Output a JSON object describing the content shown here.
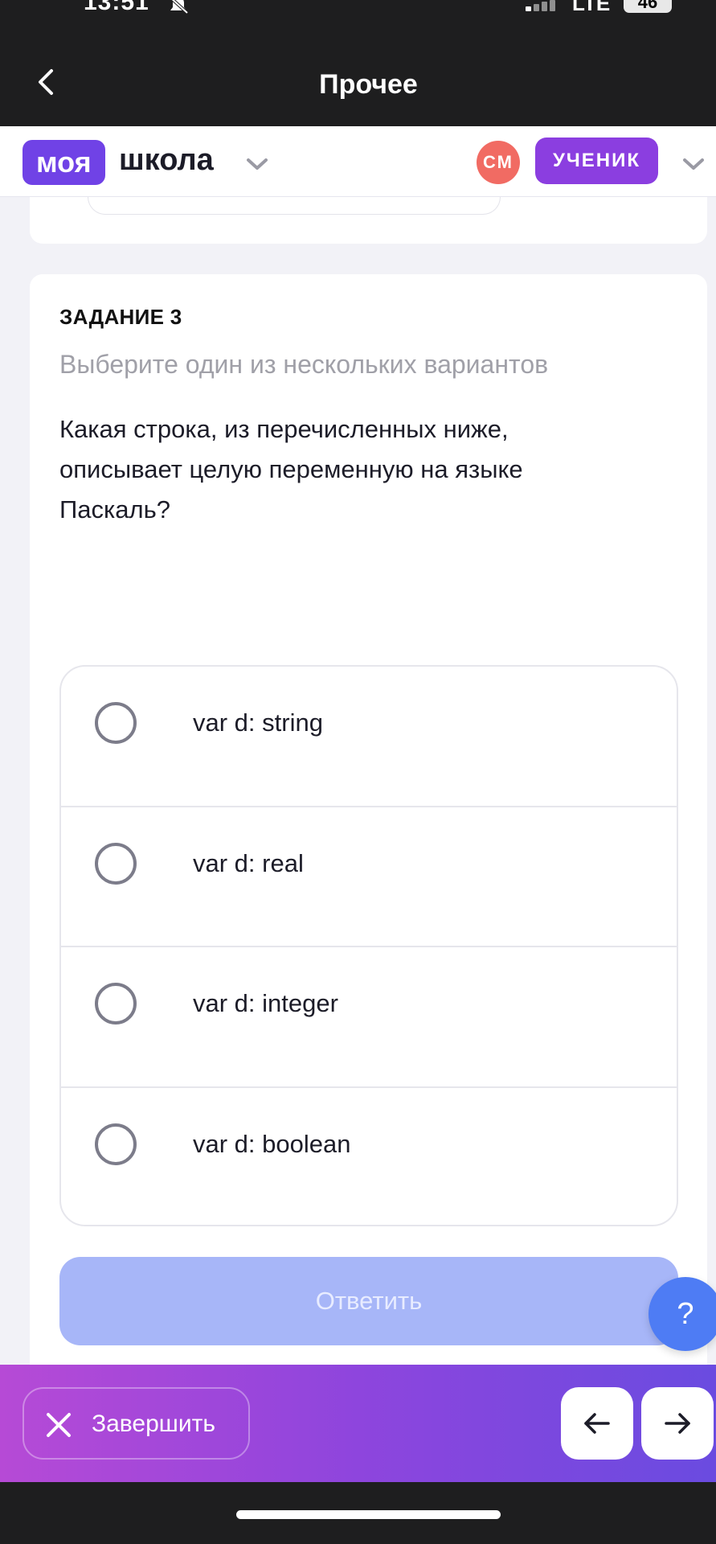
{
  "status_bar": {
    "time": "13:51",
    "network": "LTE",
    "battery": "46"
  },
  "title_bar": {
    "title": "Прочее"
  },
  "header": {
    "logo_part1": "моя",
    "logo_part2": "школа",
    "avatar_initials": "СМ",
    "role": "УЧЕНИК"
  },
  "task": {
    "title": "ЗАДАНИЕ 3",
    "subtitle": "Выберите один из нескольких вариантов",
    "question": "Какая строка, из перечисленных ниже, описывает целую переменную на языке Паскаль?",
    "options": [
      "var d: string",
      "var d: real",
      "var d: integer",
      "var d: boolean"
    ],
    "answer_button": "Ответить"
  },
  "help_button": "?",
  "bottom_bar": {
    "finish_label": "Завершить"
  },
  "colors": {
    "brand_purple": "#7042e6",
    "role_purple": "#8b3ee0",
    "avatar_red": "#f16b63",
    "answer_disabled": "#a7b6f8",
    "help_blue": "#4e7cf4"
  }
}
